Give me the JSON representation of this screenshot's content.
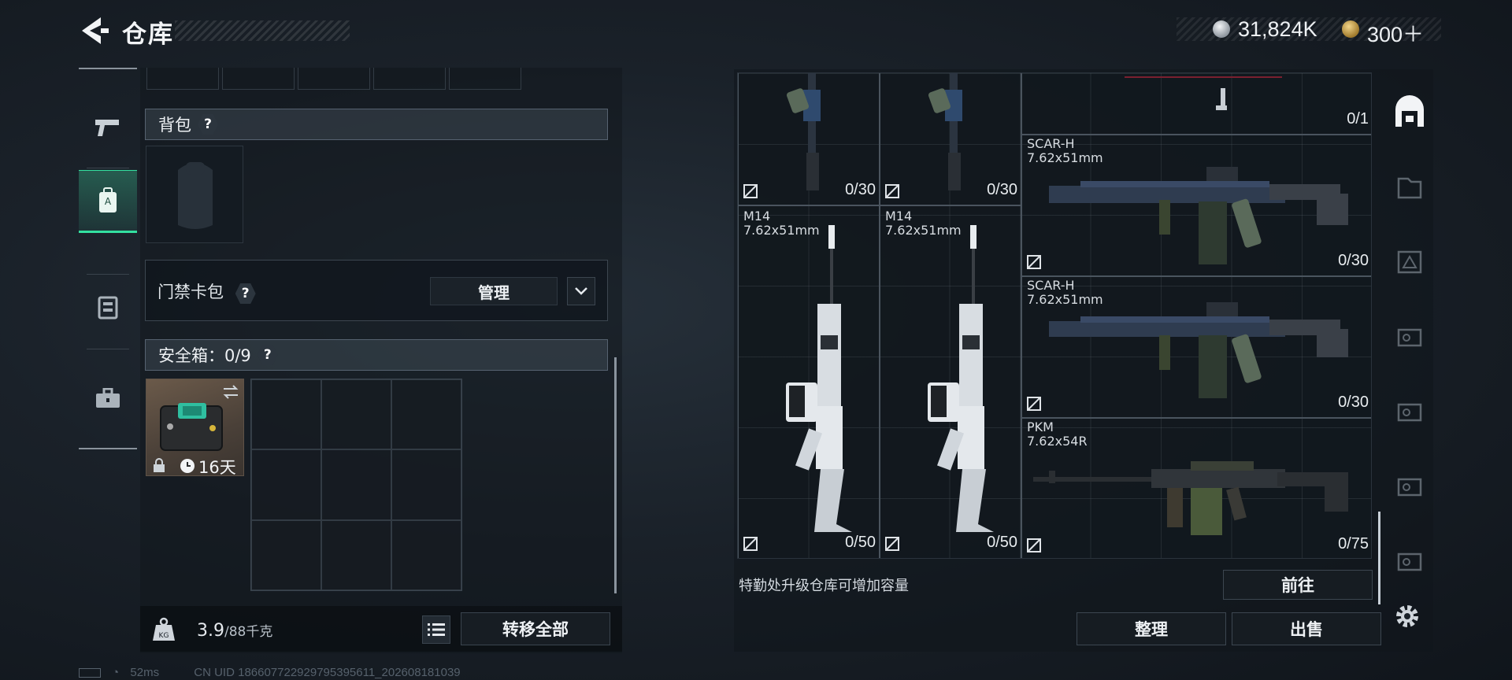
{
  "header": {
    "title": "仓库",
    "currency_1": "31,824K",
    "currency_2": "300＋"
  },
  "nav": {
    "items": [
      {
        "icon": "pistol-icon"
      },
      {
        "icon": "backpack-tab-icon",
        "active": true
      },
      {
        "icon": "vest-icon"
      },
      {
        "icon": "toolbox-icon"
      }
    ]
  },
  "left": {
    "backpack_label": "背包",
    "door_card_label": "门禁卡包",
    "manage_label": "管理",
    "safe_box_label": "安全箱：0/9",
    "safe_item_days": "16天",
    "question": "?",
    "weight_value": "3.9",
    "weight_unit": "/88千克",
    "transfer_all": "转移全部"
  },
  "stash": {
    "items": [
      {
        "count": "0/30"
      },
      {
        "count": "0/30"
      },
      {
        "count": "0/1"
      },
      {
        "name": "SCAR-H",
        "caliber": "7.62x51mm",
        "count": "0/30"
      },
      {
        "name": "M14",
        "caliber": "7.62x51mm",
        "count": "0/50"
      },
      {
        "name": "M14",
        "caliber": "7.62x51mm",
        "count": "0/50"
      },
      {
        "name": "SCAR-H",
        "caliber": "7.62x51mm",
        "count": "0/30"
      },
      {
        "name": "PKM",
        "caliber": "7.62x54R",
        "count": "0/75"
      }
    ],
    "upgrade_hint": "特勤处升级仓库可增加容量",
    "goto": "前往",
    "sort": "整理",
    "sell": "出售"
  },
  "status": {
    "ping": "52ms",
    "uid": "CN UID 1866077229297953956​11_202608181039"
  },
  "colors": {
    "accent": "#33e0a0",
    "panel": "#12181e"
  }
}
